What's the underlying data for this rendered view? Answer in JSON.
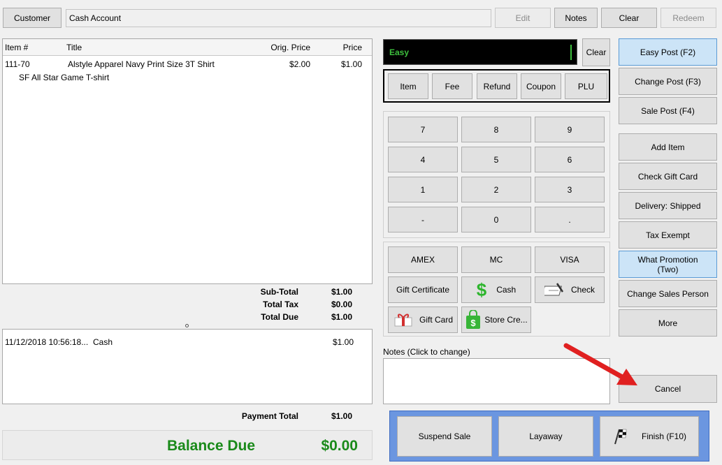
{
  "header": {
    "customer_label": "Customer",
    "customer_value": "Cash Account",
    "edit_label": "Edit",
    "notes_label": "Notes",
    "clear_label": "Clear",
    "redeem_label": "Redeem"
  },
  "items_table": {
    "columns": [
      "Item #",
      "Title",
      "Orig. Price",
      "Price"
    ],
    "rows": [
      {
        "item": "111-70",
        "title": "Alstyle Apparel Navy Print Size 3T Shirt",
        "orig_price": "$2.00",
        "price": "$1.00",
        "subtitle": "SF All Star Game T-shirt"
      }
    ]
  },
  "totals": {
    "subtotal_label": "Sub-Total",
    "subtotal": "$1.00",
    "tax_label": "Total Tax",
    "tax": "$0.00",
    "due_label": "Total Due",
    "due": "$1.00"
  },
  "payments": {
    "rows": [
      {
        "date": "11/12/2018 10:56:18...",
        "method": "Cash",
        "amount": "$1.00"
      }
    ],
    "total_label": "Payment Total",
    "total": "$1.00"
  },
  "balance": {
    "label": "Balance Due",
    "value": "$0.00",
    "color": "#1a8a1a"
  },
  "entry": {
    "mode": "Easy",
    "clear_label": "Clear"
  },
  "entry_types": [
    "Item",
    "Fee",
    "Refund",
    "Coupon",
    "PLU"
  ],
  "keypad": [
    "7",
    "8",
    "9",
    "4",
    "5",
    "6",
    "1",
    "2",
    "3",
    "-",
    "0",
    "."
  ],
  "tender": {
    "amex": "AMEX",
    "mc": "MC",
    "visa": "VISA",
    "gift_certificate": "Gift Certificate",
    "cash": "Cash",
    "check": "Check",
    "gift_card": "Gift Card",
    "store_credit": "Store Cre..."
  },
  "notes_section": {
    "label": "Notes (Click to change)"
  },
  "side": {
    "easy_post": "Easy Post (F2)",
    "change_post": "Change Post (F3)",
    "sale_post": "Sale Post (F4)",
    "add_item": "Add Item",
    "check_gift_card": "Check Gift Card",
    "delivery": "Delivery: Shipped",
    "tax_exempt": "Tax Exempt",
    "what_promotion": "What Promotion (Two)",
    "change_sales_person": "Change Sales Person",
    "more": "More",
    "cancel": "Cancel"
  },
  "footer": {
    "suspend": "Suspend Sale",
    "layaway": "Layaway",
    "finish": "Finish (F10)"
  },
  "colors": {
    "highlight": "#cce4f7",
    "accent": "#6b96e0",
    "entry_text": "#3ec03e",
    "arrow": "#e02020"
  }
}
